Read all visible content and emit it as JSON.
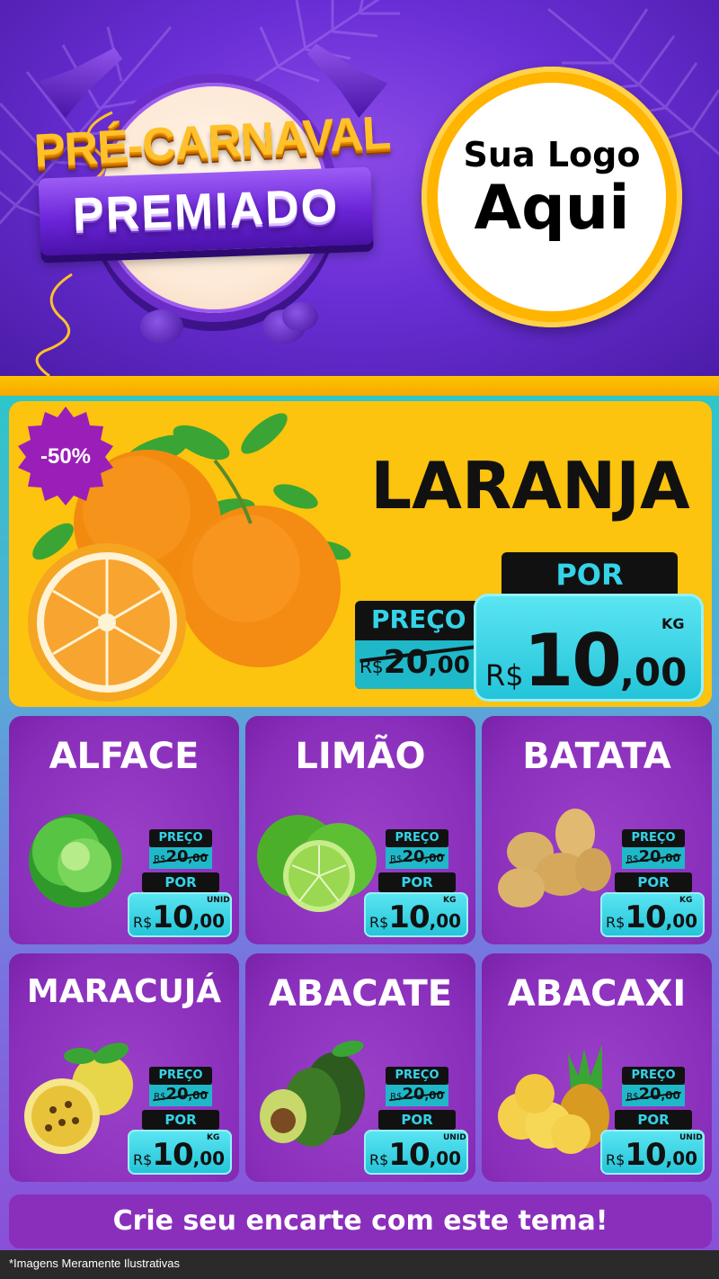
{
  "header": {
    "title_line1": "PRÉ-CARNAVAL",
    "title_line2": "PREMIADO",
    "logo_line1": "Sua Logo",
    "logo_line2": "Aqui"
  },
  "featured": {
    "name": "LARANJA",
    "discount_badge": "-50%",
    "old_price_label": "PREÇO",
    "old_price_currency": "R$",
    "old_price_int": "20",
    "old_price_cents": ",00",
    "new_price_label": "POR",
    "new_price_currency": "R$",
    "new_price_int": "10",
    "new_price_cents": ",00",
    "unit": "KG",
    "image": "orange-image"
  },
  "products": [
    {
      "name": "ALFACE",
      "unit": "UNID",
      "image": "lettuce-image"
    },
    {
      "name": "LIMÃO",
      "unit": "KG",
      "image": "lime-image"
    },
    {
      "name": "BATATA",
      "unit": "KG",
      "image": "potato-image"
    },
    {
      "name": "MARACUJÁ",
      "unit": "KG",
      "image": "passion-fruit-image"
    },
    {
      "name": "ABACATE",
      "unit": "UNID",
      "image": "avocado-image"
    },
    {
      "name": "ABACAXI",
      "unit": "UNID",
      "image": "pineapple-image"
    }
  ],
  "card_prices": {
    "old_label": "PREÇO",
    "old_currency": "R$",
    "old_int": "20",
    "old_cents": ",00",
    "new_label": "POR",
    "new_currency": "R$",
    "new_int": "10",
    "new_cents": ",00"
  },
  "cta": {
    "label": "Crie seu encarte com este tema!"
  },
  "footer": {
    "disclaimer": "*Imagens Meramente Ilustrativas"
  },
  "colors": {
    "background_purple": "#6a2fd6",
    "accent_yellow": "#fcc30f",
    "price_cyan": "#22c3d8",
    "card_purple": "#8a2fbb",
    "label_cyan": "#35d3e8"
  }
}
